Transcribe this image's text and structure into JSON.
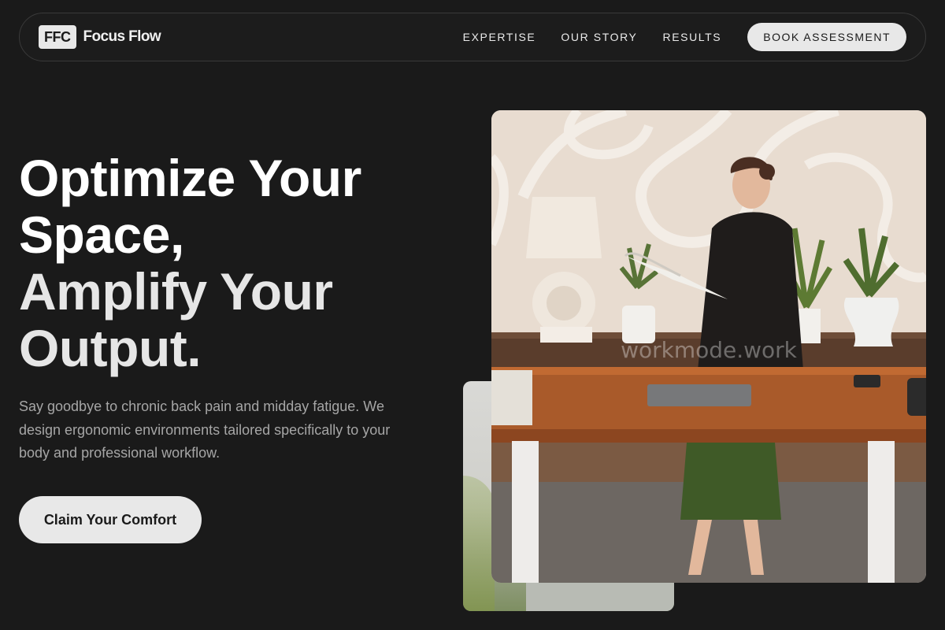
{
  "brand": {
    "badge": "FFC",
    "name": "Focus Flow"
  },
  "nav": {
    "links": [
      "EXPERTISE",
      "OUR STORY",
      "RESULTS"
    ],
    "cta": "BOOK ASSESSMENT"
  },
  "hero": {
    "headline_line1": "Optimize Your",
    "headline_line2": "Space,",
    "headline_line3": "Amplify Your",
    "headline_line4": "Output.",
    "subtext": "Say goodbye to chronic back pain and midday fatigue. We design ergonomic environments tailored specifically to your body and professional workflow.",
    "cta": "Claim Your Comfort"
  },
  "photo": {
    "watermark": "workmode.work"
  },
  "colors": {
    "background": "#1a1a1a",
    "button": "#e8e8e8",
    "subtext": "#a6a6a6"
  }
}
